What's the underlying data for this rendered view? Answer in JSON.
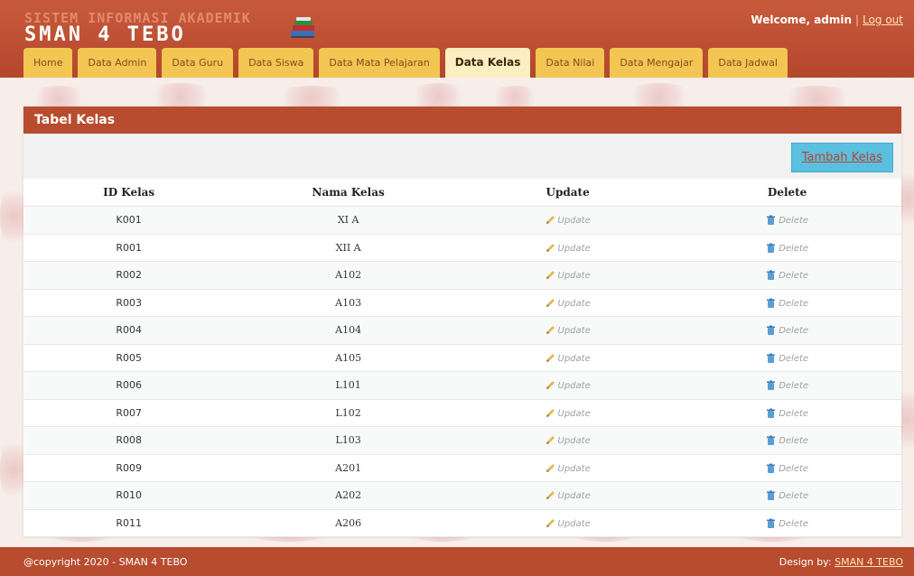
{
  "header": {
    "logo_line1": "SISTEM INFORMASI AKADEMIK",
    "logo_line2": "SMAN 4 TEBO",
    "welcome_prefix": "Welcome, admin",
    "logout_label": "Log out",
    "logo_icon": "books-icon"
  },
  "nav": {
    "tabs": [
      {
        "label": "Home"
      },
      {
        "label": "Data Admin"
      },
      {
        "label": "Data Guru"
      },
      {
        "label": "Data Siswa"
      },
      {
        "label": "Data Mata Pelajaran"
      },
      {
        "label": "Data Kelas"
      },
      {
        "label": "Data Nilai"
      },
      {
        "label": "Data Mengajar"
      },
      {
        "label": "Data Jadwal"
      }
    ],
    "active_tab": "Data Kelas"
  },
  "main": {
    "title": "Tabel Kelas",
    "add_button_label": "Tambah Kelas",
    "columns": [
      "ID Kelas",
      "Nama Kelas",
      "Update",
      "Delete"
    ],
    "update_label": "Update",
    "delete_label": "Delete",
    "rows": [
      {
        "id": "K001",
        "nama": "XI A"
      },
      {
        "id": "R001",
        "nama": "XII A"
      },
      {
        "id": "R002",
        "nama": "A102"
      },
      {
        "id": "R003",
        "nama": "A103"
      },
      {
        "id": "R004",
        "nama": "A104"
      },
      {
        "id": "R005",
        "nama": "A105"
      },
      {
        "id": "R006",
        "nama": "L101"
      },
      {
        "id": "R007",
        "nama": "L102"
      },
      {
        "id": "R008",
        "nama": "L103"
      },
      {
        "id": "R009",
        "nama": "A201"
      },
      {
        "id": "R010",
        "nama": "A202"
      },
      {
        "id": "R011",
        "nama": "A206"
      }
    ]
  },
  "footer": {
    "copyright": "@copyright 2020 - SMAN 4 TEBO",
    "design_prefix": "Design by:",
    "design_link": "SMAN 4 TEBO"
  },
  "colors": {
    "header": "#b84c2f",
    "tab": "#f3c552",
    "tab_active": "#fbeec0",
    "add_button": "#5bbfe0"
  }
}
